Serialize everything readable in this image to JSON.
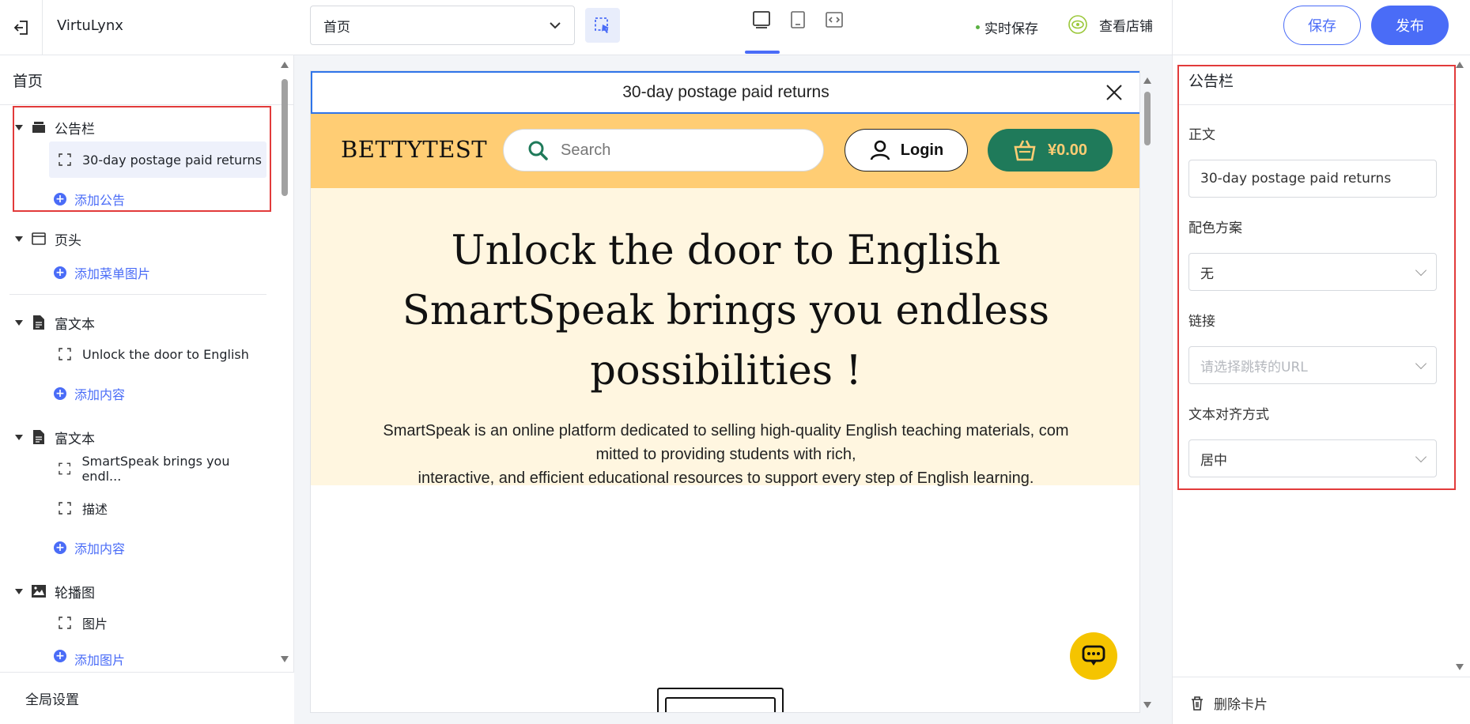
{
  "topbar": {
    "app_name": "VirtuLynx",
    "page_select": "首页",
    "realtime_save": "实时保存",
    "view_store": "查看店铺",
    "save": "保存",
    "publish": "发布"
  },
  "left": {
    "title": "首页",
    "sections": [
      {
        "label": "公告栏",
        "children": [
          "30-day postage paid returns"
        ],
        "add": "添加公告"
      },
      {
        "label": "页头",
        "children": [],
        "add": "添加菜单图片"
      },
      {
        "label": "富文本",
        "children": [
          "Unlock the door to English"
        ],
        "add": "添加内容"
      },
      {
        "label": "富文本",
        "children": [
          "SmartSpeak brings you endl...",
          "描述"
        ],
        "add": "添加内容"
      },
      {
        "label": "轮播图",
        "children": [
          "图片"
        ],
        "add": "添加图片"
      }
    ],
    "global_settings": "全局设置"
  },
  "canvas": {
    "announcement": "30-day postage paid returns",
    "brand": "BETTYTEST",
    "search_placeholder": "Search",
    "login": "Login",
    "cart": "¥0.00",
    "hero_title_1": "Unlock the door to English",
    "hero_title_2": "SmartSpeak brings you endless",
    "hero_title_3": "possibilities !",
    "hero_desc_1": "SmartSpeak is an online platform dedicated to selling high-quality English teaching materials, com",
    "hero_desc_2": "mitted to providing students with rich,",
    "hero_desc_3": "interactive, and efficient educational resources to support every step of English learning."
  },
  "right": {
    "title": "公告栏",
    "body_label": "正文",
    "body_value": "30-day postage paid returns",
    "color_label": "配色方案",
    "color_value": "无",
    "link_label": "链接",
    "link_placeholder": "请选择跳转的URL",
    "align_label": "文本对齐方式",
    "align_value": "居中",
    "delete_card": "删除卡片"
  },
  "colors": {
    "accent": "#4a6cf7",
    "highlight_border": "#e23b3b",
    "header_bg": "#ffcd74",
    "hero_bg": "#fff6e0",
    "cart_bg": "#1f7a5a",
    "chat_fab": "#f5c400"
  }
}
